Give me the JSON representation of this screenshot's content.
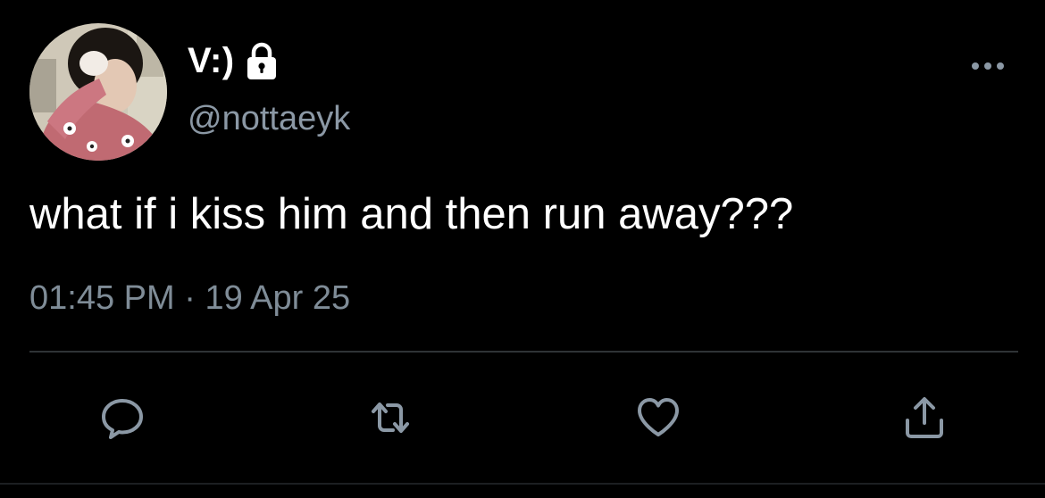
{
  "tweet": {
    "display_name": "V:)",
    "handle": "@nottaeyk",
    "text": "what if i kiss him and then run away???",
    "time": "01:45 PM",
    "separator": " · ",
    "date": "19 Apr 25"
  },
  "icons": {
    "lock": "lock-icon",
    "more": "more-horizontal-icon",
    "reply": "reply-icon",
    "retweet": "retweet-icon",
    "like": "heart-icon",
    "share": "share-icon"
  },
  "colors": {
    "background": "#000000",
    "text": "#ffffff",
    "secondary": "#8b98a5",
    "divider": "#2f3336",
    "icon": "#8b98a5"
  }
}
